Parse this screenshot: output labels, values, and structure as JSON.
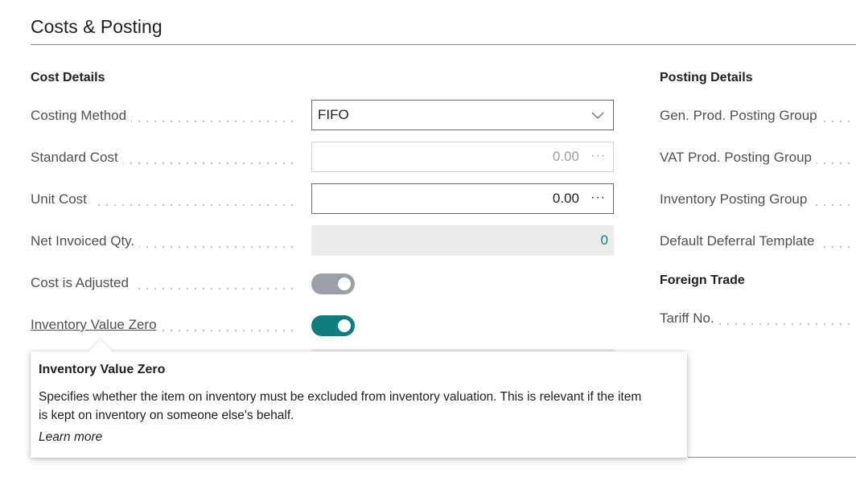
{
  "page": {
    "title": "Costs & Posting"
  },
  "cost_details": {
    "heading": "Cost Details",
    "costing_method": {
      "label": "Costing Method",
      "value": "FIFO"
    },
    "standard_cost": {
      "label": "Standard Cost",
      "value": "0.00",
      "more": "···"
    },
    "unit_cost": {
      "label": "Unit Cost",
      "value": "0.00",
      "more": "···"
    },
    "net_invoiced_qty": {
      "label": "Net Invoiced Qty.",
      "value": "0"
    },
    "cost_is_adjusted": {
      "label": "Cost is Adjusted",
      "state": "off"
    },
    "inventory_value_zero": {
      "label": "Inventory Value Zero",
      "state": "on"
    }
  },
  "posting_details": {
    "heading": "Posting Details",
    "fields": [
      {
        "label": "Gen. Prod. Posting Group"
      },
      {
        "label": "VAT Prod. Posting Group"
      },
      {
        "label": "Inventory Posting Group"
      },
      {
        "label": "Default Deferral Template"
      }
    ]
  },
  "foreign_trade": {
    "heading": "Foreign Trade",
    "tariff_no": {
      "label": "Tariff No."
    }
  },
  "tooltip": {
    "title": "Inventory Value Zero",
    "body": "Specifies whether the item on inventory must be excluded from inventory valuation. This is relevant if the item is kept on inventory on someone else's behalf.",
    "link": "Learn more"
  },
  "colors": {
    "accent": "#0f7c7e",
    "toggle_off": "#9c9fa6",
    "readonly_bg": "#ececec"
  },
  "icons": {
    "dropdown": "chevron-down-icon",
    "more": "ellipsis-icon"
  }
}
